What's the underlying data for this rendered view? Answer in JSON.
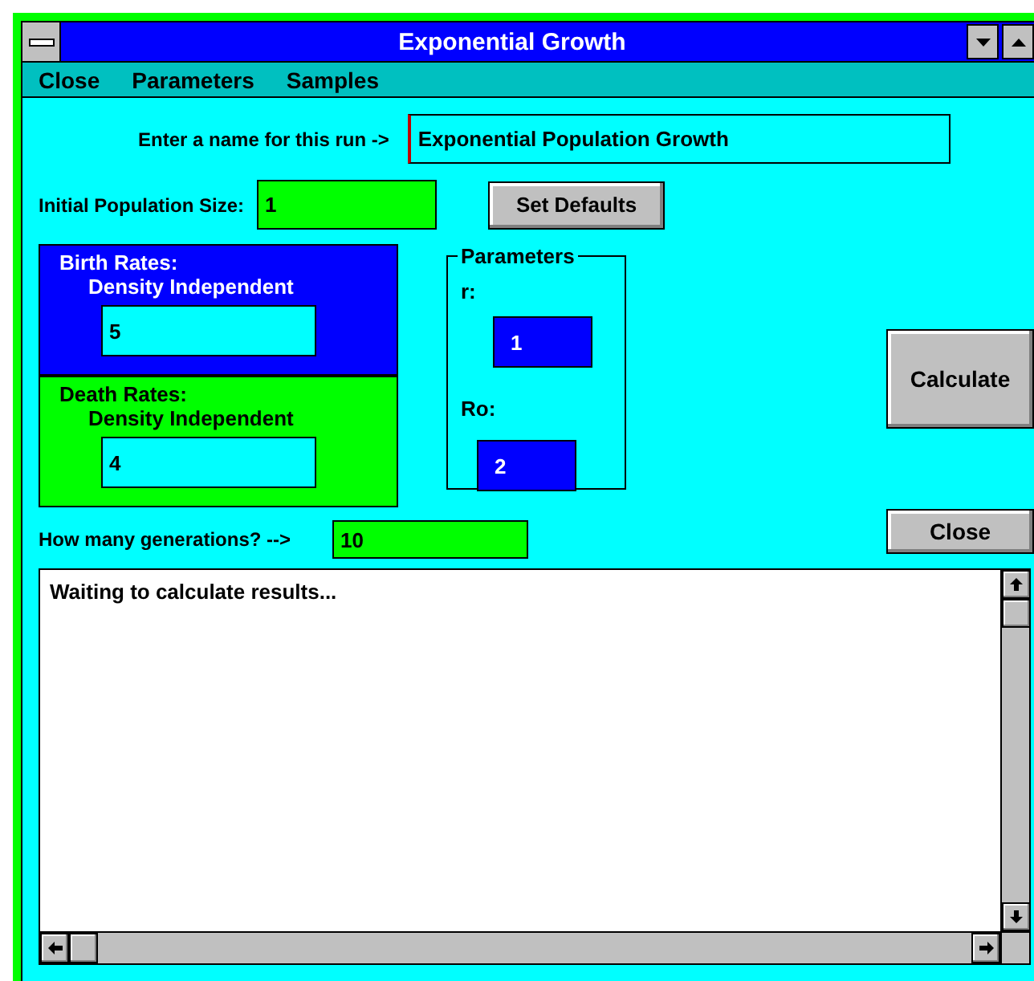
{
  "window": {
    "title": "Exponential Growth"
  },
  "menu": [
    "Close",
    "Parameters",
    "Samples"
  ],
  "run_name": {
    "label": "Enter a name for this run ->",
    "value": "Exponential Population Growth"
  },
  "initial_population": {
    "label": "Initial Population Size:",
    "value": "1"
  },
  "set_defaults_button": "Set Defaults",
  "birth_rates": {
    "title": "Birth Rates:",
    "subtitle": "Density Independent",
    "value": "5"
  },
  "death_rates": {
    "title": "Death Rates:",
    "subtitle": "Density Independent",
    "value": "4"
  },
  "parameters": {
    "title": "Parameters",
    "fields": [
      {
        "label": "r:",
        "value": "1"
      },
      {
        "label": "Ro:",
        "value": "2"
      }
    ]
  },
  "calculate_button": "Calculate",
  "generations": {
    "label": "How many generations? -->",
    "value": "10"
  },
  "close_button": "Close",
  "results": {
    "text": "Waiting to calculate results..."
  }
}
